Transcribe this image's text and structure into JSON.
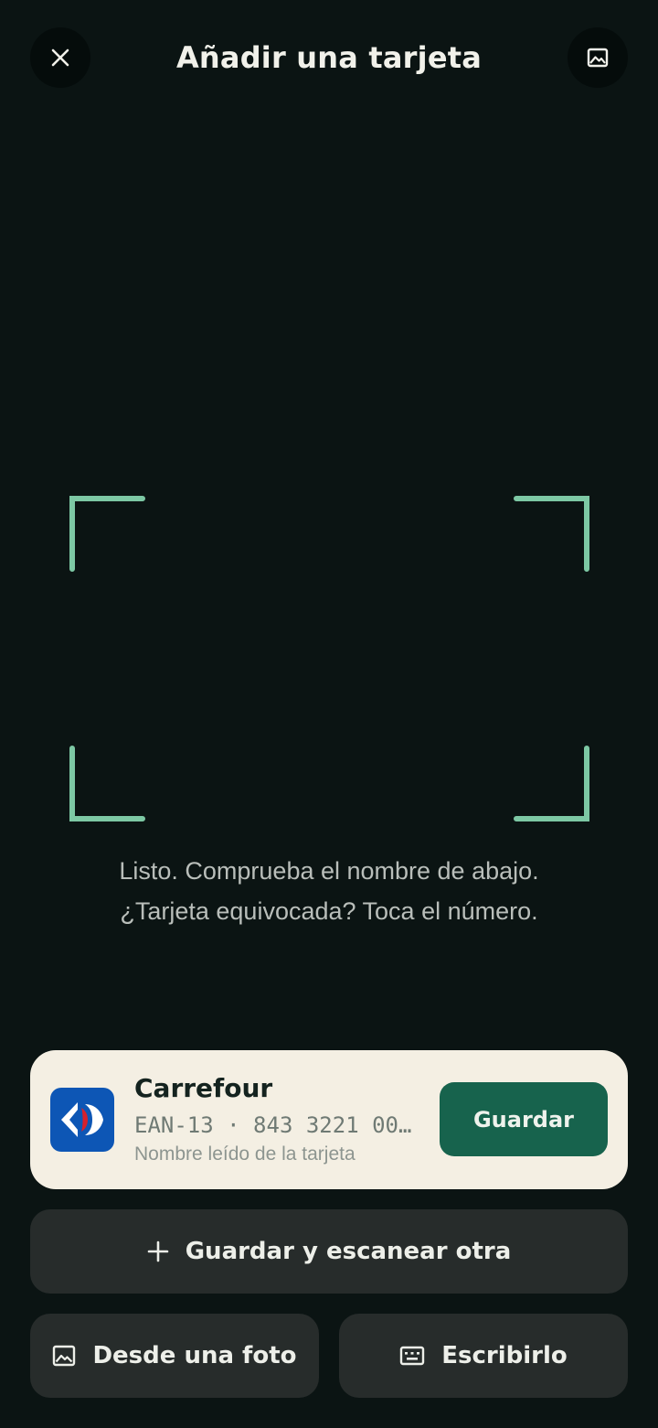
{
  "header": {
    "title": "Añadir una tarjeta",
    "close_icon": "close-icon",
    "gallery_icon": "image-icon"
  },
  "scanner": {
    "frame_color": "#7dc8a4",
    "hint_line1": "Listo. Comprueba el nombre de abajo.",
    "hint_line2": "¿Tarjeta equivocada? Toca el número."
  },
  "result_card": {
    "store_name": "Carrefour",
    "barcode": "EAN-13 · 843 3221 00…",
    "source_label": "Nombre leído de la tarjeta",
    "logo_icon": "carrefour-logo",
    "logo_color": "#0d56b5",
    "save_label": "Guardar",
    "save_color": "#17634d"
  },
  "actions": {
    "save_and_scan_label": "Guardar y escanear otra",
    "from_photo_label": "Desde una foto",
    "type_label": "Escribirlo"
  },
  "colors": {
    "background": "#0b1413",
    "card_background": "#f4efe3",
    "button_background": "#272c2b"
  }
}
